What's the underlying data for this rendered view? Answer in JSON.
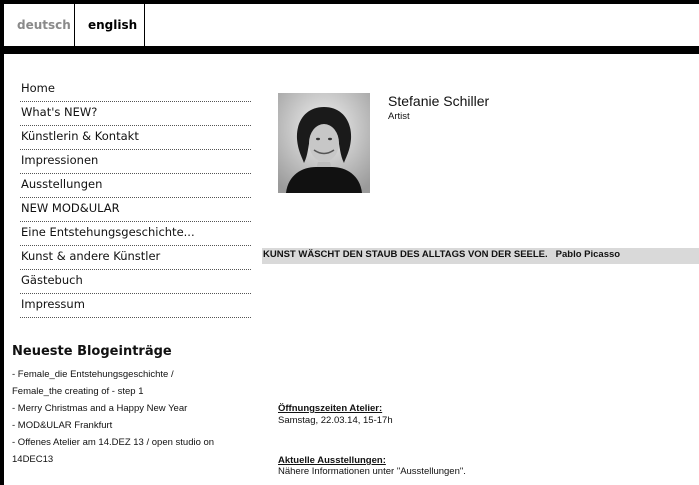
{
  "language": {
    "de_label": "deutsch",
    "en_label": "english",
    "active": "english"
  },
  "nav": {
    "items": [
      "Home",
      "What's NEW?",
      "Künstlerin & Kontakt",
      "Impressionen",
      "Ausstellungen",
      "NEW MOD&ULAR",
      "Eine Entstehungsgeschichte...",
      "Kunst & andere Künstler",
      "Gästebuch",
      "Impressum"
    ]
  },
  "blog": {
    "title": "Neueste Blogeinträge",
    "lines": [
      "- Female_die Entstehungsgeschichte /",
      "Female_the creating of - step 1",
      "- Merry Christmas and a Happy New Year",
      "- MOD&ULAR Frankfurt",
      "- Offenes Atelier am 14.DEZ 13 / open studio on",
      "14DEC13"
    ]
  },
  "profile": {
    "name": "Stefanie Schiller",
    "role": "Artist"
  },
  "quote": {
    "text": "KUNST WÄSCHT DEN STAUB DES ALLTAGS VON DER SEELE.",
    "author": "Pablo Picasso"
  },
  "info": {
    "opening_heading": "Öffnungszeiten Atelier:",
    "opening_text": "Samstag, 22.03.14, 15-17h",
    "exhibitions_heading": "Aktuelle Ausstellungen:",
    "exhibitions_text": "Nähere Informationen unter \"Ausstellungen\"."
  },
  "colors": {
    "frame": "#000000",
    "quote_bg": "#d9d9d9",
    "inactive_lang": "#8a8a8a"
  }
}
